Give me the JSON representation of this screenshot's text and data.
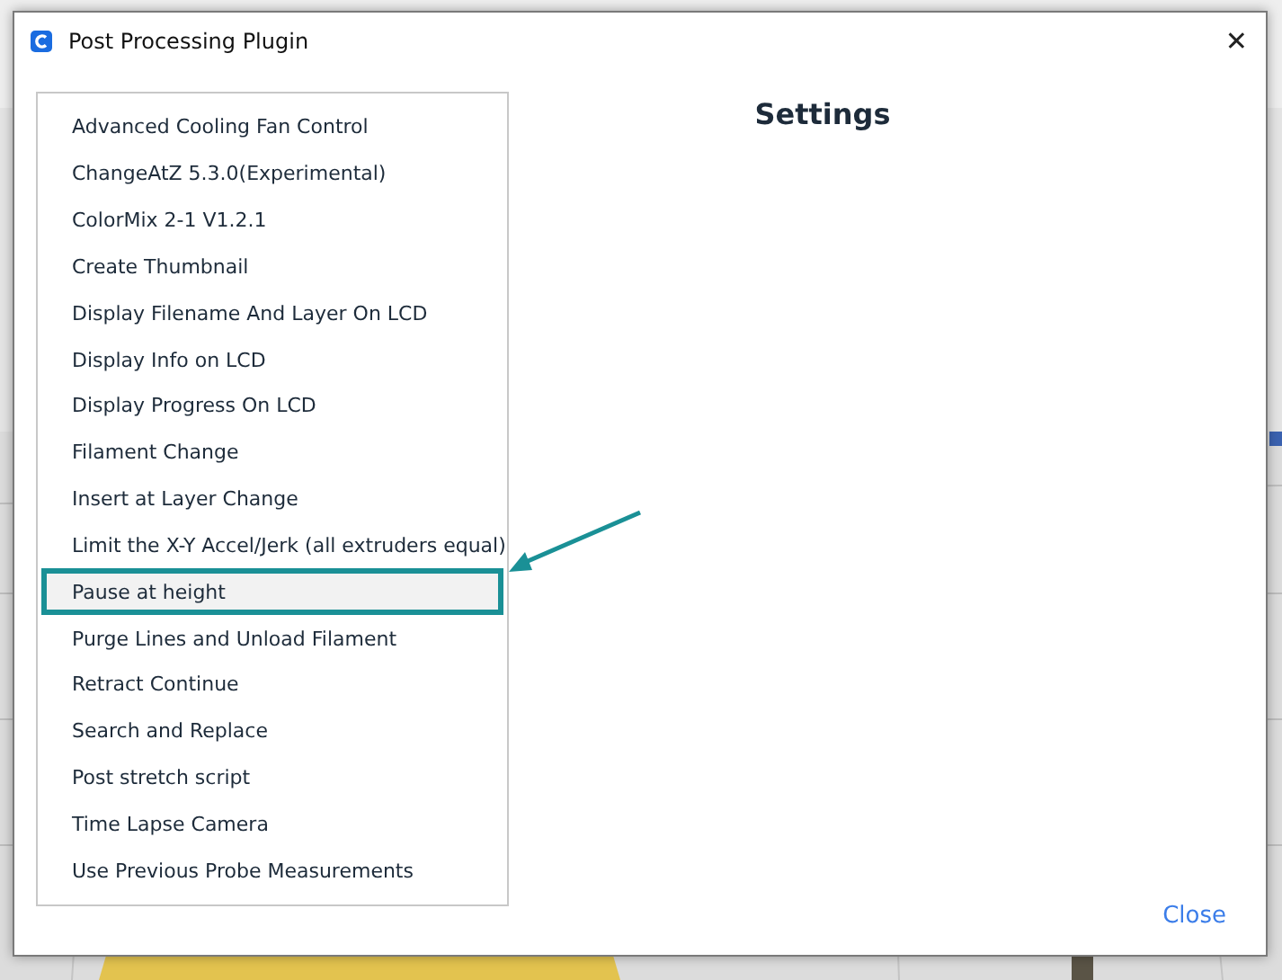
{
  "window": {
    "title": "Post Processing Plugin",
    "close_glyph": "✕"
  },
  "scripts": [
    {
      "label": "Advanced Cooling Fan Control",
      "selected": false
    },
    {
      "label": "ChangeAtZ 5.3.0(Experimental)",
      "selected": false
    },
    {
      "label": "ColorMix 2-1 V1.2.1",
      "selected": false
    },
    {
      "label": "Create Thumbnail",
      "selected": false
    },
    {
      "label": "Display Filename And Layer On LCD",
      "selected": false
    },
    {
      "label": "Display Info on LCD",
      "selected": false
    },
    {
      "label": "Display Progress On LCD",
      "selected": false
    },
    {
      "label": "Filament Change",
      "selected": false
    },
    {
      "label": "Insert at Layer Change",
      "selected": false
    },
    {
      "label": "Limit the X-Y Accel/Jerk (all extruders equal)",
      "selected": false
    },
    {
      "label": "Pause at height",
      "selected": true
    },
    {
      "label": "Purge Lines and Unload Filament",
      "selected": false
    },
    {
      "label": "Retract Continue",
      "selected": false
    },
    {
      "label": "Search and Replace",
      "selected": false
    },
    {
      "label": "Post stretch script",
      "selected": false
    },
    {
      "label": "Time Lapse Camera",
      "selected": false
    },
    {
      "label": "Use Previous Probe Measurements",
      "selected": false
    }
  ],
  "settings": {
    "title": "Settings"
  },
  "close_button": "Close"
}
